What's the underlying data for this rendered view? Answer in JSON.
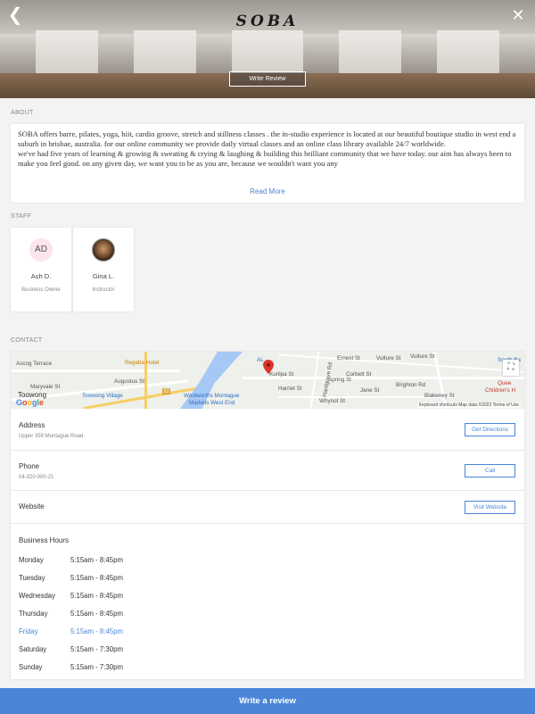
{
  "header": {
    "logo": "SOBA",
    "back_icon": "chevron-left-icon",
    "close_icon": "close-icon",
    "write_review_label": "Write Review"
  },
  "about": {
    "section_label": "ABOUT",
    "paragraphs": [
      "SOBA offers barre, pilates, yoga, hiit, cardio groove, stretch and stillness classes . the in-studio experience is located at our beautiful boutique studio in west end a suburb in brisbae, australia. for our online community we provide daily virtual classes and an online class library available 24/7 worldwide.",
      "we've had five years of learning & growing & sweating & crying & laughing & building this brilliant community that we have today. our aim has always been to make you feel good.  on any given day, we want you to be as you are, because we wouldn't want you any"
    ],
    "read_more_label": "Read More"
  },
  "staff": {
    "section_label": "STAFF",
    "members": [
      {
        "initials": "AD",
        "name": "Ash D.",
        "role": "Business Owner"
      },
      {
        "initials": "",
        "name": "Gina L.",
        "role": "Instructor"
      }
    ]
  },
  "contact": {
    "section_label": "CONTACT",
    "map": {
      "labels": {
        "vulture_st_1": "Vulture St",
        "vulture_st_2": "Vulture St",
        "regatta_hotel": "Regatta Hotel",
        "toowong_village": "Toowong Village",
        "toowong": "Toowong",
        "woolworths": "Woolworths Montague",
        "markets_west_end": "Markets West End",
        "south_bank": "South Ba",
        "queensland_childrens": "Quee",
        "childrens_h": "Children's H",
        "ascog_terrace": "Ascog Terrace",
        "maryvale_st": "Maryvale St",
        "augustus_st": "Augustus St",
        "corbett_st": "Corbett St",
        "spring_st": "Spring St",
        "brighton_rd": "Brighton Rd",
        "hardgrave_rd": "Hardgrave Rd",
        "whynot_st": "Whynot St",
        "harriet_st": "Harriet St",
        "kurilpa_st": "Kurilpa St",
        "jane_st": "Jane St",
        "ernest_st": "Ernest St",
        "blakeney_st": "Blakeney St",
        "al": "AL",
        "route_32": "32",
        "google": "Google",
        "attribution": "Keyboard shortcuts   Map data ©2022   Terms of Use"
      },
      "fullscreen_icon": "fullscreen-icon",
      "pin_icon": "map-pin-icon"
    },
    "address": {
      "label": "Address",
      "value": "Upper 359 Montague Road",
      "button": "Get Directions"
    },
    "phone": {
      "label": "Phone",
      "value": "04-320-900-21",
      "button": "Call"
    },
    "website": {
      "label": "Website",
      "button": "Visit Website"
    },
    "hours": {
      "title": "Business Hours",
      "days": [
        {
          "day": "Monday",
          "time": "5:15am - 8:45pm",
          "today": false
        },
        {
          "day": "Tuesday",
          "time": "5:15am - 8:45pm",
          "today": false
        },
        {
          "day": "Wednesday",
          "time": "5:15am - 8:45pm",
          "today": false
        },
        {
          "day": "Thursday",
          "time": "5:15am - 8:45pm",
          "today": false
        },
        {
          "day": "Friday",
          "time": "5:15am - 8:45pm",
          "today": true
        },
        {
          "day": "Saturday",
          "time": "5:15am - 7:30pm",
          "today": false
        },
        {
          "day": "Sunday",
          "time": "5:15am - 7:30pm",
          "today": false
        }
      ]
    }
  },
  "footer": {
    "write_review_label": "Write a review"
  },
  "colors": {
    "accent": "#4a86d8",
    "today": "#4a86d8"
  }
}
